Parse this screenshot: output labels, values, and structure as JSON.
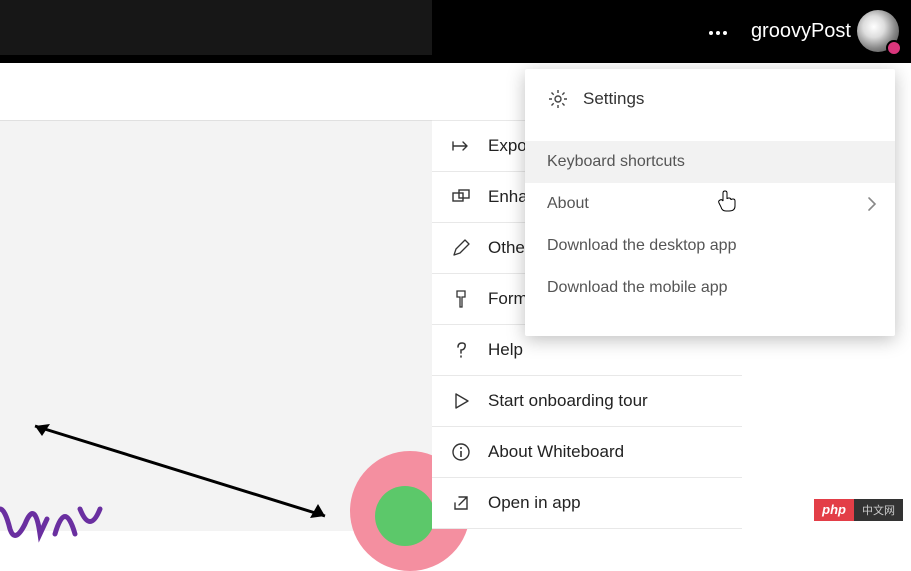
{
  "topbar": {
    "user_name": "groovyPost"
  },
  "menu1": {
    "items": [
      {
        "label": "Export"
      },
      {
        "label": "Enhance"
      },
      {
        "label": "Other"
      },
      {
        "label": "Format"
      },
      {
        "label": "Help"
      },
      {
        "label": "Start onboarding tour"
      },
      {
        "label": "About Whiteboard"
      },
      {
        "label": "Open in app"
      }
    ]
  },
  "menu2": {
    "items": [
      {
        "label": "Settings"
      },
      {
        "label": "Keyboard shortcuts"
      },
      {
        "label": "About"
      },
      {
        "label": "Download the desktop app"
      },
      {
        "label": "Download the mobile app"
      }
    ]
  },
  "badge": {
    "left": "php",
    "right": "中文网"
  }
}
